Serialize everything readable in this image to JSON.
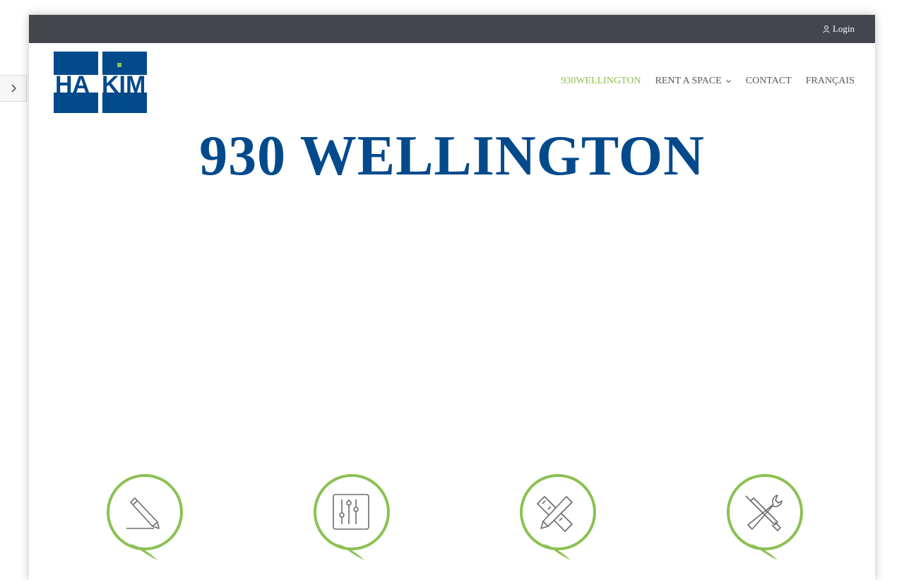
{
  "topbar": {
    "login_label": "Login"
  },
  "brand": {
    "logo_text_left": "HA",
    "logo_text_right": "KIM",
    "primary_color": "#024a8c",
    "accent_color": "#8bc152"
  },
  "nav": {
    "items": [
      {
        "label": "930WELLINGTON",
        "active": true
      },
      {
        "label": "RENT A SPACE",
        "has_dropdown": true
      },
      {
        "label": "CONTACT"
      },
      {
        "label": "FRANÇAIS"
      }
    ]
  },
  "hero": {
    "title": "930 WELLINGTON"
  },
  "features": {
    "icons": [
      "pencil-icon",
      "sliders-icon",
      "pencil-ruler-icon",
      "tools-icon"
    ]
  }
}
